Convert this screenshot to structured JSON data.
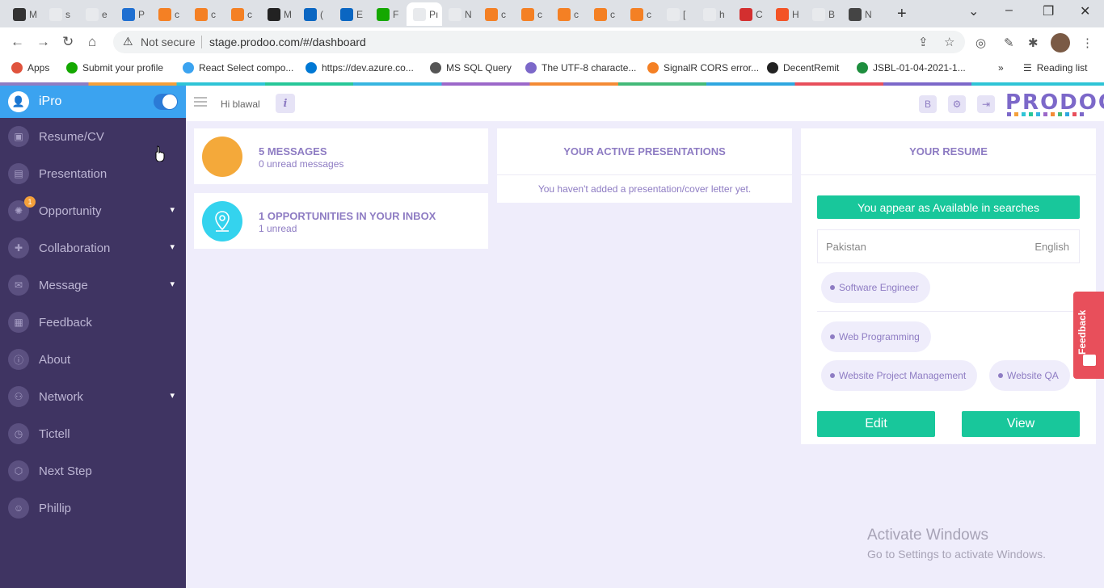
{
  "browser": {
    "tabs": [
      {
        "label": "M",
        "color": "#333"
      },
      {
        "label": "s",
        "color": "#fff"
      },
      {
        "label": "e",
        "color": "#fff"
      },
      {
        "label": "P",
        "color": "#1f6fd1"
      },
      {
        "label": "c",
        "color": "#f48024"
      },
      {
        "label": "c",
        "color": "#f48024"
      },
      {
        "label": "c",
        "color": "#f48024"
      },
      {
        "label": "M",
        "color": "#222"
      },
      {
        "label": "(",
        "color": "#0a66c2"
      },
      {
        "label": "E",
        "color": "#0a66c2"
      },
      {
        "label": "F",
        "color": "#14a800"
      },
      {
        "label": "Pı",
        "color": "#fff"
      },
      {
        "label": "N",
        "color": "#fff"
      },
      {
        "label": "c",
        "color": "#f48024"
      },
      {
        "label": "c",
        "color": "#f48024"
      },
      {
        "label": "c",
        "color": "#f48024"
      },
      {
        "label": "c",
        "color": "#f48024"
      },
      {
        "label": "c",
        "color": "#f48024"
      },
      {
        "label": "[",
        "color": "#fff"
      },
      {
        "label": "h",
        "color": "#fff"
      },
      {
        "label": "C",
        "color": "#d32f2f"
      },
      {
        "label": "H",
        "color": "#f35325"
      },
      {
        "label": "B",
        "color": "#fff"
      },
      {
        "label": "N",
        "color": "#444"
      }
    ],
    "url_security": "Not secure",
    "url": "stage.prodoo.com/#/dashboard",
    "bookmarks": [
      {
        "label": "Apps",
        "color": "#e0533d"
      },
      {
        "label": "Submit your profile",
        "color": "#14a800"
      },
      {
        "label": "React Select compo...",
        "color": "#3ba3f0"
      },
      {
        "label": "https://dev.azure.co...",
        "color": "#0078d4"
      },
      {
        "label": "MS SQL Query",
        "color": "#555"
      },
      {
        "label": "The UTF-8 characte...",
        "color": "#7c68c9"
      },
      {
        "label": "SignalR CORS error...",
        "color": "#f48024"
      },
      {
        "label": "DecentRemit",
        "color": "#222"
      },
      {
        "label": "JSBL-01-04-2021-1...",
        "color": "#1e8e3e"
      }
    ],
    "bookmarks_more": "»",
    "reading_list": "Reading list"
  },
  "sidebar": {
    "title": "iPro",
    "items": [
      {
        "label": "Resume/CV",
        "icon": "id-card-icon",
        "chevron": false
      },
      {
        "label": "Presentation",
        "icon": "presentation-icon",
        "chevron": false
      },
      {
        "label": "Opportunity",
        "icon": "lightbulb-icon",
        "chevron": true,
        "badge": "1"
      },
      {
        "label": "Collaboration",
        "icon": "puzzle-icon",
        "chevron": true
      },
      {
        "label": "Message",
        "icon": "envelope-icon",
        "chevron": true
      },
      {
        "label": "Feedback",
        "icon": "feedback-icon",
        "chevron": false
      },
      {
        "label": "About",
        "icon": "info-icon",
        "chevron": false
      },
      {
        "label": "Network",
        "icon": "network-icon",
        "chevron": true
      },
      {
        "label": "Tictell",
        "icon": "clock-icon",
        "chevron": false
      },
      {
        "label": "Next Step",
        "icon": "next-step-icon",
        "chevron": false
      },
      {
        "label": "Phillip",
        "icon": "assistant-icon",
        "chevron": false
      }
    ]
  },
  "topbar": {
    "greeting": "Hi blawal",
    "info_label": "i",
    "logo": "PRODOO",
    "logo_colors": [
      "#7c68c9",
      "#f4a03a",
      "#2ec4d6",
      "#27c799",
      "#37b5e0",
      "#9c68c9",
      "#f48b35",
      "#43b979",
      "#2ea7e0",
      "#e84f5b",
      "#7c68c9"
    ]
  },
  "messages_card": {
    "title": "5 MESSAGES",
    "subtitle": "0 unread messages",
    "color": "#f4a93a"
  },
  "opportunities_card": {
    "title": "1 OPPORTUNITIES IN YOUR INBOX",
    "subtitle": "1 unread",
    "color": "#34d3ee"
  },
  "presentations": {
    "title": "YOUR ACTIVE PRESENTATIONS",
    "empty": "You haven't added a presentation/cover letter yet."
  },
  "resume": {
    "title": "YOUR RESUME",
    "availability": "You appear as Available in searches",
    "location": "Pakistan",
    "language": "English",
    "role": "Software Engineer",
    "skills": [
      "Web Programming",
      "Website Project Management",
      "Website QA"
    ],
    "edit_label": "Edit",
    "view_label": "View"
  },
  "feedback_tab": "Feedback",
  "watermark": {
    "line1": "Activate Windows",
    "line2": "Go to Settings to activate Windows."
  }
}
